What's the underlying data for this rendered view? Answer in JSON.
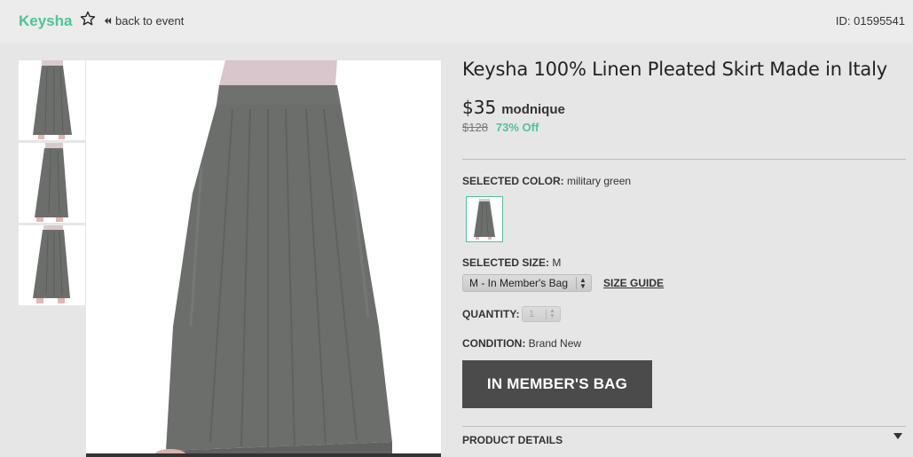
{
  "header": {
    "brand": "Keysha",
    "back_label": "back to event",
    "product_id": "ID: 01595541"
  },
  "product": {
    "title": "Keysha 100% Linen Pleated Skirt Made in Italy",
    "price": "$35",
    "seller": "modnique",
    "original_price": "$128",
    "discount": "73% Off"
  },
  "color": {
    "label": "SELECTED COLOR:",
    "value": "military green"
  },
  "size": {
    "label": "SELECTED SIZE:",
    "value": "M",
    "select_value": "M - In Member's Bag",
    "guide_label": "SIZE GUIDE"
  },
  "quantity": {
    "label": "QUANTITY:",
    "value": "1"
  },
  "condition": {
    "label": "CONDITION:",
    "value": "Brand New"
  },
  "bag_button_label": "IN MEMBER'S BAG",
  "details_label": "PRODUCT DETAILS",
  "colors": {
    "accent": "#4cc594",
    "skirt": "#6b6e6b",
    "button": "#4b4b4b"
  },
  "icons": [
    "star-icon",
    "double-chevron-left-icon",
    "caret-down-icon"
  ]
}
